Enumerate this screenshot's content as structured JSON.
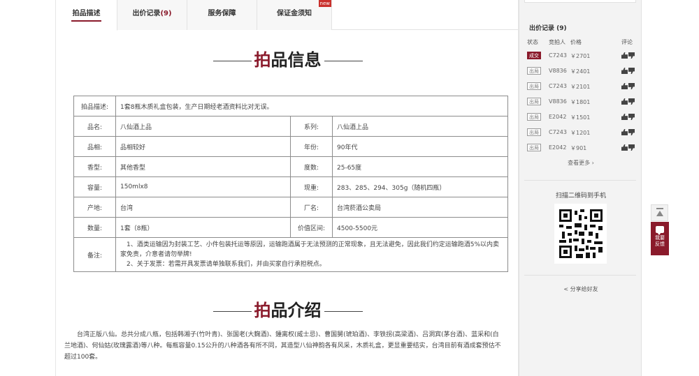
{
  "tabs": [
    {
      "label": "拍品描述",
      "active": true
    },
    {
      "label": "出价记录",
      "count": "(9)"
    },
    {
      "label": "服务保障"
    },
    {
      "label": "保证金须知",
      "badge": "new"
    }
  ],
  "section1": {
    "first_char": "拍",
    "rest": "品信息"
  },
  "info": {
    "desc_label": "拍品描述:",
    "desc_value": "1套8瓶木质礼盒包装，生产日期经老酒资料比对无误。",
    "rows": [
      {
        "l1": "品名:",
        "v1": "八仙酒上品",
        "l2": "系列:",
        "v2": "八仙酒上品"
      },
      {
        "l1": "品相:",
        "v1": "品相较好",
        "l2": "年份:",
        "v2": "90年代"
      },
      {
        "l1": "香型:",
        "v1": "其他香型",
        "l2": "度数:",
        "v2": "25-65度"
      },
      {
        "l1": "容量:",
        "v1": "150mlx8",
        "l2": "现重:",
        "v2": "283、285、294、305g（随机四瓶）"
      },
      {
        "l1": "产地:",
        "v1": "台湾",
        "l2": "厂名:",
        "v2": "台湾菸酒公卖局"
      },
      {
        "l1": "数量:",
        "v1": "1套（8瓶）",
        "l2": "价值区间:",
        "v2": "4500-5500元"
      }
    ],
    "note_label": "备注:",
    "note_line1": "1、酒类运输因为封装工艺、小件包装托运等原因，运输跑酒属于无法预测的正常现象，且无法避免，因此我们约定运输跑酒5%以内卖家免责，介意者请勿举牌!",
    "note_line2": "2、关于发票：若需开具发票请单独联系我们，并由买家自行承担税点。"
  },
  "section2": {
    "first_char": "拍",
    "rest": "品介绍"
  },
  "intro_text": "台湾正版八仙。总共分成八瓶，包括韩湘子(竹叶青)、张国老(大麴酒)、鍾离权(威士忌)、曹国舅(琥珀酒)、李铁拐(高梁酒)、吕洞宾(茅台酒)、蓝采和(白兰地酒)、何仙姑(玫瑰露酒)等八种。每瓶容量0.15公升的八种酒各有所不同，其造型八仙神韵各有风采，木质礼盒，更显重要结实，台湾目前有酒成套预估不超过100套。",
  "sidebar": {
    "bids_title": "出价记录 (9)",
    "head": {
      "status": "状态",
      "bidder": "竞拍人",
      "price": "价格",
      "comment": "评论"
    },
    "bids": [
      {
        "status": "成交",
        "win": true,
        "bidder": "C7243",
        "price": "￥2701"
      },
      {
        "status": "出局",
        "bidder": "V8836",
        "price": "￥2401"
      },
      {
        "status": "出局",
        "bidder": "C7243",
        "price": "￥2101"
      },
      {
        "status": "出局",
        "bidder": "V8836",
        "price": "￥1801"
      },
      {
        "status": "出局",
        "bidder": "E2042",
        "price": "￥1501"
      },
      {
        "status": "出局",
        "bidder": "C7243",
        "price": "￥1201"
      },
      {
        "status": "出局",
        "bidder": "E2042",
        "price": "￥901"
      }
    ],
    "more": "查看更多 ›",
    "qr_title": "扫描二维码到手机",
    "share": "分享给好友"
  },
  "float": {
    "feedback": "我要\n反馈"
  },
  "colors": {
    "accent": "#8a1a2b"
  }
}
